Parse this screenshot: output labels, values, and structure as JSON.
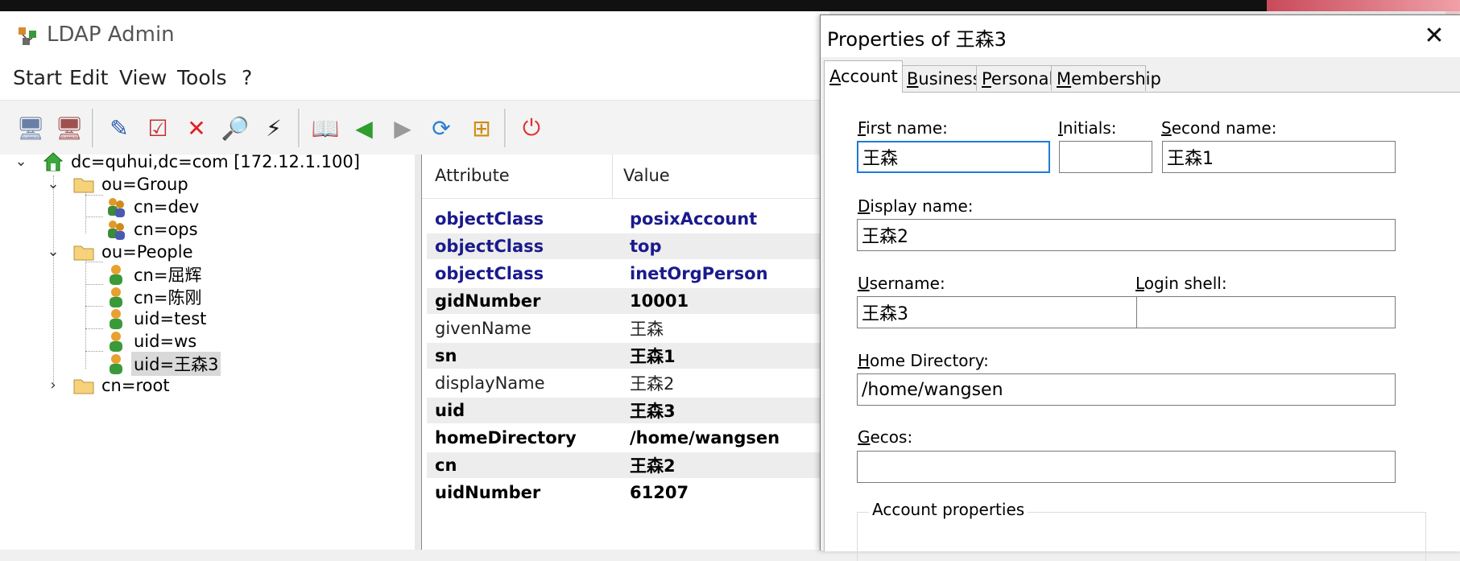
{
  "main_window": {
    "title": "LDAP Admin",
    "menu": [
      "Start",
      "Edit",
      "View",
      "Tools",
      "?"
    ]
  },
  "toolbar": {
    "buttons": [
      {
        "name": "connect-icon",
        "glyph": "🖥"
      },
      {
        "name": "disconnect-icon",
        "glyph": "🖥"
      },
      {
        "name": "edit-entry-icon",
        "glyph": "✎"
      },
      {
        "name": "properties-icon",
        "glyph": "☑"
      },
      {
        "name": "delete-icon",
        "glyph": "✕"
      },
      {
        "name": "search-icon",
        "glyph": "🔎"
      },
      {
        "name": "lightning-icon",
        "glyph": "⚡"
      },
      {
        "name": "schema-book-icon",
        "glyph": "📖"
      },
      {
        "name": "back-arrow-icon",
        "glyph": "◀"
      },
      {
        "name": "forward-arrow-icon",
        "glyph": "▶"
      },
      {
        "name": "refresh-icon",
        "glyph": "⟳"
      },
      {
        "name": "tree-org-icon",
        "glyph": "⊞"
      },
      {
        "name": "exit-icon",
        "glyph": "⏻"
      }
    ]
  },
  "tree": {
    "root": "dc=quhui,dc=com [172.12.1.100]",
    "group_ou": "ou=Group",
    "group_children": [
      "cn=dev",
      "cn=ops"
    ],
    "people_ou": "ou=People",
    "people_children": [
      "cn=屈辉",
      "cn=陈刚",
      "uid=test",
      "uid=ws",
      "uid=王森3"
    ],
    "root_cn": "cn=root"
  },
  "attributes": {
    "header": {
      "attribute": "Attribute",
      "value": "Value"
    },
    "rows": [
      {
        "name": "objectClass",
        "value": "posixAccount",
        "kind": "oc"
      },
      {
        "name": "objectClass",
        "value": "top",
        "kind": "oc"
      },
      {
        "name": "objectClass",
        "value": "inetOrgPerson",
        "kind": "oc"
      },
      {
        "name": "gidNumber",
        "value": "10001",
        "kind": "req"
      },
      {
        "name": "givenName",
        "value": "王森",
        "kind": "opt"
      },
      {
        "name": "sn",
        "value": "王森1",
        "kind": "req"
      },
      {
        "name": "displayName",
        "value": "王森2",
        "kind": "opt"
      },
      {
        "name": "uid",
        "value": "王森3",
        "kind": "req"
      },
      {
        "name": "homeDirectory",
        "value": "/home/wangsen",
        "kind": "req"
      },
      {
        "name": "cn",
        "value": "王森2",
        "kind": "req"
      },
      {
        "name": "uidNumber",
        "value": "61207",
        "kind": "req"
      }
    ]
  },
  "dialog": {
    "title": "Properties of 王森3",
    "close_glyph": "✕",
    "tabs": [
      {
        "label": "Account",
        "mnemonic": "A",
        "rest": "ccount"
      },
      {
        "label": "Business",
        "mnemonic": "B",
        "rest": "usiness"
      },
      {
        "label": "Personal",
        "mnemonic": "P",
        "rest": "ersonal"
      },
      {
        "label": "Membership",
        "mnemonic": "M",
        "rest": "embership"
      }
    ],
    "fields": {
      "first_name": {
        "label_m": "F",
        "label_r": "irst name:",
        "value": "王森"
      },
      "initials": {
        "label_m": "I",
        "label_r": "nitials:",
        "value": ""
      },
      "second_name": {
        "label_m": "S",
        "label_r": "econd name:",
        "value": "王森1"
      },
      "display_name": {
        "label_m": "D",
        "label_r": "isplay name:",
        "value": "王森2"
      },
      "username": {
        "label_m": "U",
        "label_r": "sername:",
        "value": "王森3"
      },
      "login_shell": {
        "label_m": "L",
        "label_r": "ogin shell:",
        "value": ""
      },
      "home_directory": {
        "label_m": "H",
        "label_r": "ome Directory:",
        "value": "/home/wangsen"
      },
      "gecos": {
        "label_m": "G",
        "label_r": "ecos:",
        "value": ""
      }
    },
    "group_label": "Account properties"
  },
  "colors": {
    "objectclass_text": "#1a1a8c",
    "focus_border": "#1e7bd6",
    "selection_bg": "#d9d9d9"
  }
}
